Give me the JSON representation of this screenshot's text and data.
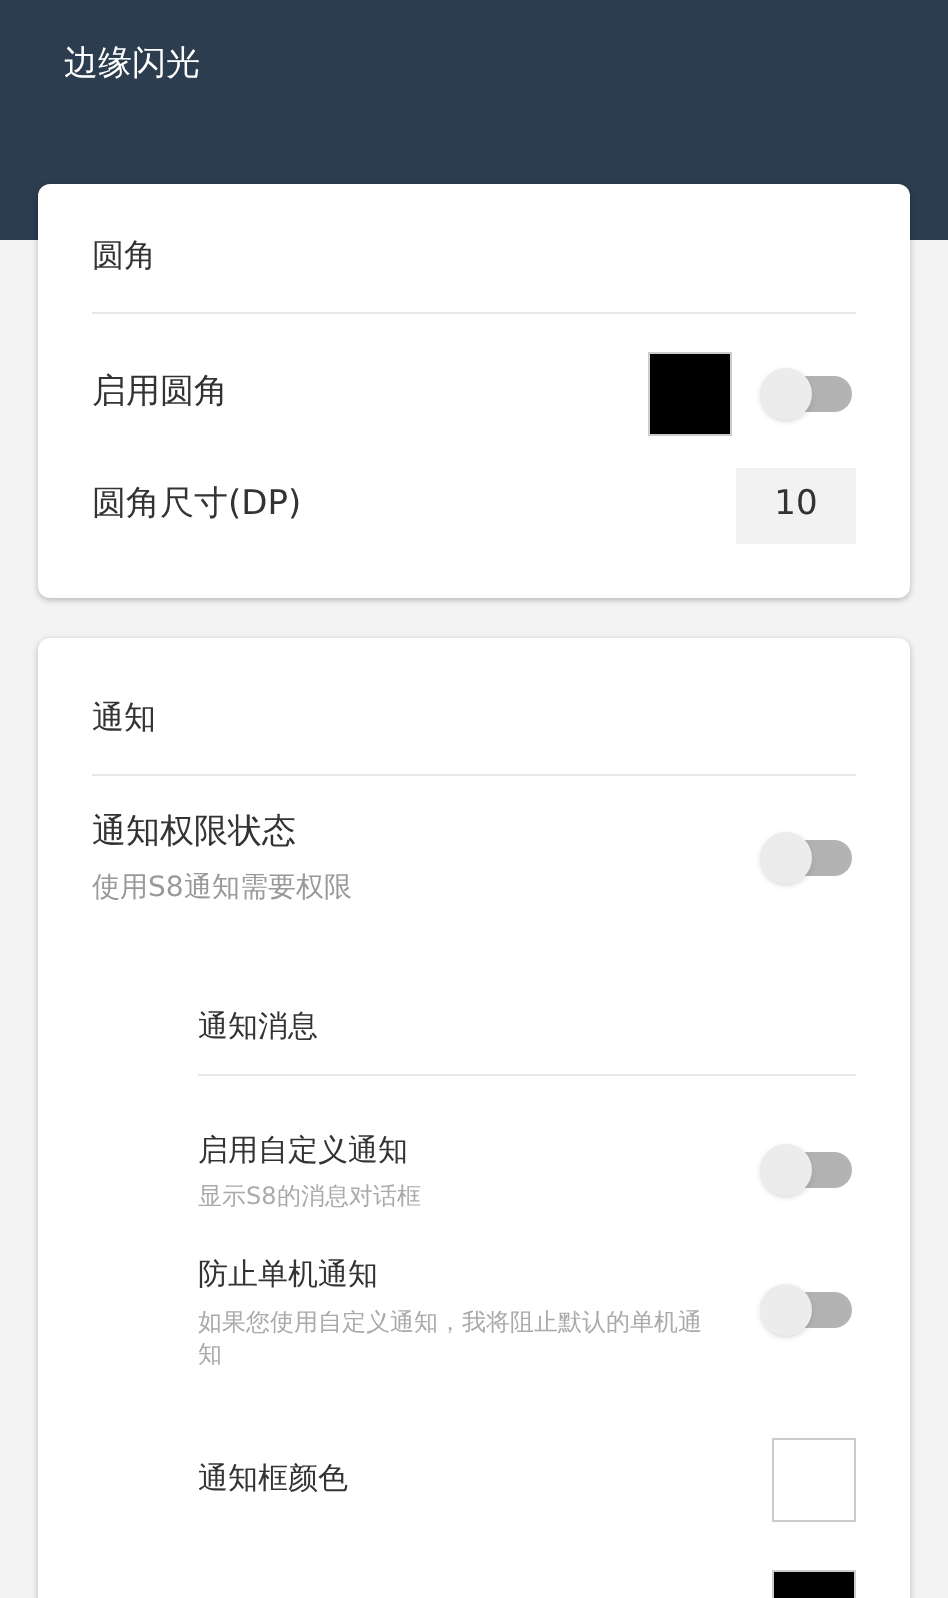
{
  "app_bar": {
    "title": "边缘闪光"
  },
  "sections": [
    {
      "title": "圆角",
      "items": [
        {
          "kind": "color_switch",
          "label": "启用圆角",
          "color": "#000000",
          "on": false
        },
        {
          "kind": "number",
          "label": "圆角尺寸(DP)",
          "value": "10"
        }
      ]
    },
    {
      "title": "通知",
      "items": [
        {
          "kind": "switch",
          "label": "通知权限状态",
          "summary": "使用S8通知需要权限",
          "on": false
        },
        {
          "kind": "subheader",
          "label": "通知消息",
          "children": [
            {
              "kind": "switch",
              "label": "启用自定义通知",
              "summary": "显示S8的消息对话框",
              "on": false
            },
            {
              "kind": "switch",
              "label": "防止单机通知",
              "summary": "如果您使用自定义通知，我将阻止默认的单机通知",
              "on": false
            },
            {
              "kind": "color",
              "label": "通知框颜色",
              "color": "#ffffff"
            },
            {
              "kind": "color",
              "color": "#000000"
            }
          ]
        }
      ]
    }
  ]
}
